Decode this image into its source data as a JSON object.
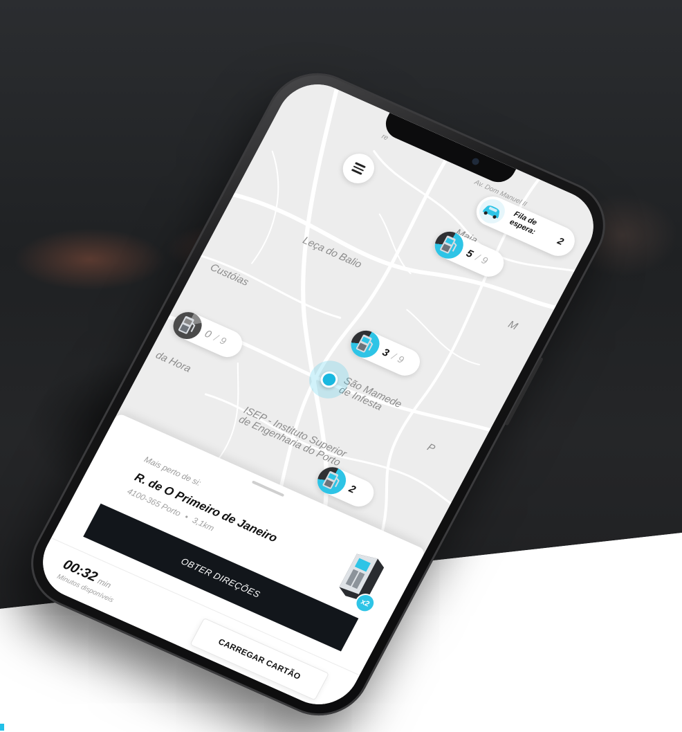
{
  "map": {
    "street_top": "Av. Dom Manuel II",
    "places": {
      "maia": "Maia",
      "leca_do_balio": "Leça do Balio",
      "custoias": "Custóias",
      "sao_mamede": "São Mamede\nde Infesta",
      "da_hora": "da Hora",
      "isep": "ISEP - Instituto Superior\nde Engenharia do Porto",
      "partial_m": "M",
      "partial_p": "P",
      "partial_re": "re"
    },
    "queue": {
      "label_line1": "Fila de",
      "label_line2": "espera:",
      "count": "2"
    },
    "pins": [
      {
        "available": "5",
        "total": "9"
      },
      {
        "available": "3",
        "total": "9"
      },
      {
        "available": "0",
        "total": "9"
      },
      {
        "available": "2",
        "total": ""
      }
    ],
    "icons": [
      "menu-icon",
      "car-icon",
      "charging-station-icon",
      "location-dot-icon"
    ],
    "colors": {
      "accent": "#2ec4e6",
      "dark": "#12161b"
    }
  },
  "sheet": {
    "near_label": "Mais perto de si:",
    "street": "R. de O Primeiro de Janeiro",
    "postal": "4100-365 Porto",
    "distance": "3,1km",
    "badge": "x2",
    "directions_button": "OBTER DIREÇÕES",
    "time_value": "00:32",
    "time_unit": "min",
    "time_label": "Minutos disponíveis",
    "card_button": "CARREGAR CARTÃO"
  }
}
